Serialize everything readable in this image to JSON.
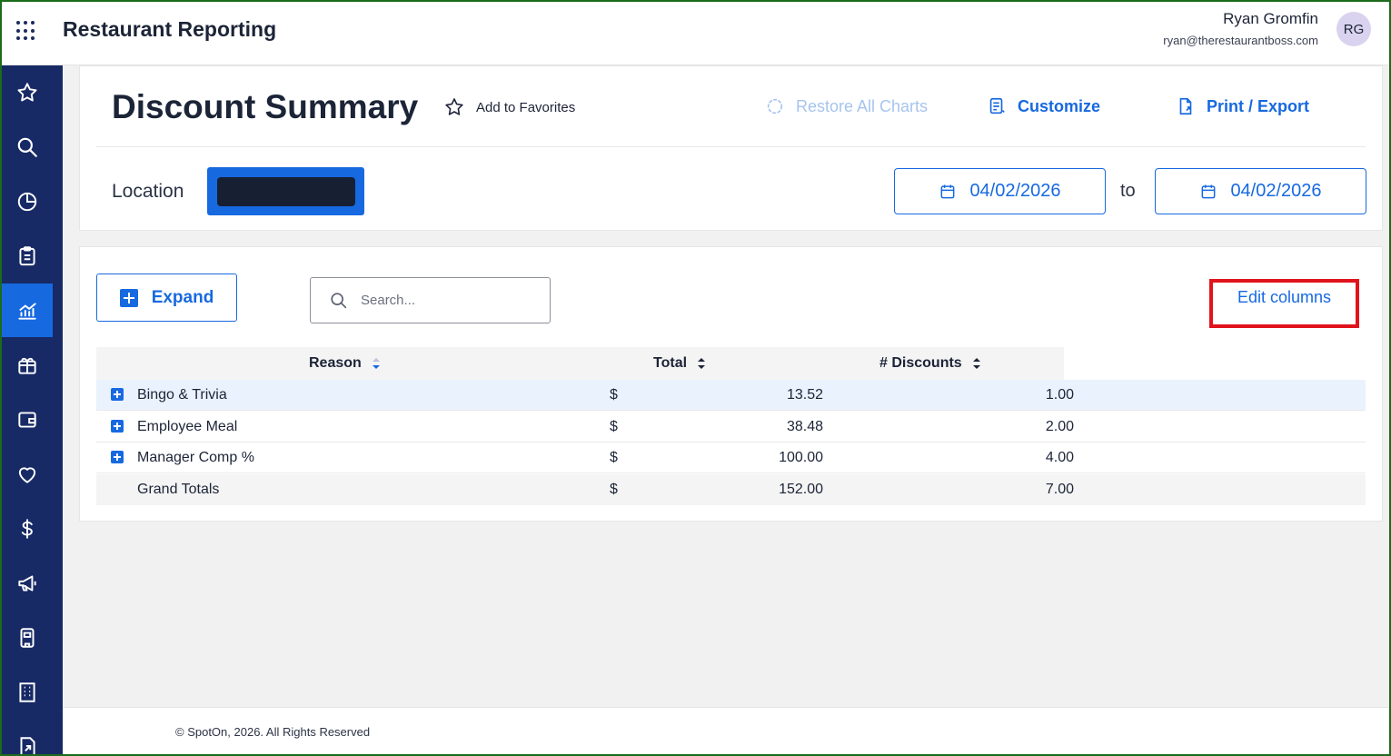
{
  "app": {
    "title": "Restaurant Reporting"
  },
  "user": {
    "name": "Ryan Gromfin",
    "email": "ryan@therestaurantboss.com",
    "initials": "RG"
  },
  "sidebar": {
    "items": [
      {
        "icon": "star-icon"
      },
      {
        "icon": "search-icon"
      },
      {
        "icon": "pie-chart-icon"
      },
      {
        "icon": "clipboard-icon"
      },
      {
        "icon": "analytics-icon",
        "active": true
      },
      {
        "icon": "gift-icon"
      },
      {
        "icon": "wallet-icon"
      },
      {
        "icon": "heart-icon"
      },
      {
        "icon": "dollar-icon"
      },
      {
        "icon": "megaphone-icon"
      },
      {
        "icon": "terminal-icon"
      },
      {
        "icon": "building-icon"
      },
      {
        "icon": "export-doc-icon"
      }
    ]
  },
  "header": {
    "title": "Discount Summary",
    "add_to_favorites": "Add to Favorites",
    "restore_all_charts": "Restore All Charts",
    "customize": "Customize",
    "print_export": "Print / Export",
    "location_label": "Location",
    "date_from": "04/02/2026",
    "date_to_label": "to",
    "date_to": "04/02/2026"
  },
  "report": {
    "expand_label": "Expand",
    "search_placeholder": "Search...",
    "edit_columns": "Edit columns",
    "columns": {
      "reason": "Reason",
      "total": "Total",
      "discounts": "# Discounts"
    },
    "rows": [
      {
        "reason": "Bingo & Trivia",
        "currency": "$",
        "total": "13.52",
        "discounts": "1.00"
      },
      {
        "reason": "Employee Meal",
        "currency": "$",
        "total": "38.48",
        "discounts": "2.00"
      },
      {
        "reason": "Manager Comp %",
        "currency": "$",
        "total": "100.00",
        "discounts": "4.00"
      }
    ],
    "grand_totals": {
      "reason": "Grand Totals",
      "currency": "$",
      "total": "152.00",
      "discounts": "7.00"
    }
  },
  "footer": {
    "copyright": "© SpotOn, 2026. All Rights Reserved"
  },
  "colors": {
    "primary": "#1769e0",
    "sidebar": "#172a66",
    "highlight": "#e0141b"
  }
}
